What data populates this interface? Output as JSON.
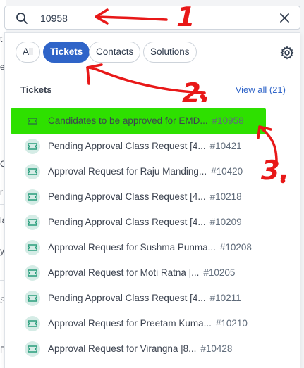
{
  "search": {
    "value": "10958",
    "placeholder": ""
  },
  "tabs": [
    {
      "label": "All",
      "active": false
    },
    {
      "label": "Tickets",
      "active": true
    },
    {
      "label": "Contacts",
      "active": false
    },
    {
      "label": "Solutions",
      "active": false
    }
  ],
  "section": {
    "title": "Tickets",
    "view_all": "View all (21)"
  },
  "results": [
    {
      "title": "Candidates to be approved for EMD...",
      "number": "#10958"
    },
    {
      "title": "Pending Approval Class Request [4...",
      "number": "#10421"
    },
    {
      "title": "Approval Request for Raju Manding...",
      "number": "#10420"
    },
    {
      "title": "Pending Approval Class Request [4...",
      "number": "#10218"
    },
    {
      "title": "Pending Approval Class Request [4...",
      "number": "#10209"
    },
    {
      "title": "Approval Request for Sushma Punma...",
      "number": "#10208"
    },
    {
      "title": "Approval Request for Moti Ratna |...",
      "number": "#10205"
    },
    {
      "title": "Pending Approval Class Request [4...",
      "number": "#10211"
    },
    {
      "title": "Approval Request for Preetam Kuma...",
      "number": "#10210"
    },
    {
      "title": "Approval Request for Virangna |8...",
      "number": "#10428"
    }
  ],
  "annotations": {
    "label_1": "1",
    "label_2": "2.",
    "label_3": "3."
  },
  "background_fragments": [
    "t",
    "e",
    "Cl",
    "r",
    "la",
    "y",
    "St",
    "Pr"
  ],
  "colors": {
    "accent": "#2f64c8",
    "highlight": "#2ee000",
    "annotation": "#e81818",
    "ticket_icon": "#2a9d7c"
  }
}
